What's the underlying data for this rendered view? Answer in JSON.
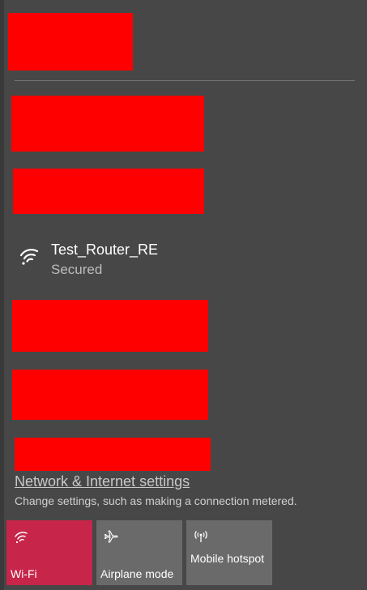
{
  "network": {
    "name": "Test_Router_RE",
    "status": "Secured",
    "icon": "wifi-icon"
  },
  "settings": {
    "link_label": "Network & Internet settings",
    "description": "Change settings, such as making a connection metered."
  },
  "tiles": [
    {
      "label": "Wi-Fi",
      "icon": "wifi-icon",
      "active": true
    },
    {
      "label": "Airplane mode",
      "icon": "airplane-icon",
      "active": false
    },
    {
      "label": "Mobile hotspot",
      "icon": "hotspot-icon",
      "active": false
    }
  ],
  "colors": {
    "panel_background": "#474747",
    "accent_active_tile": "#c7254a",
    "inactive_tile": "#6a6a6a",
    "redaction": "#ff0000"
  }
}
